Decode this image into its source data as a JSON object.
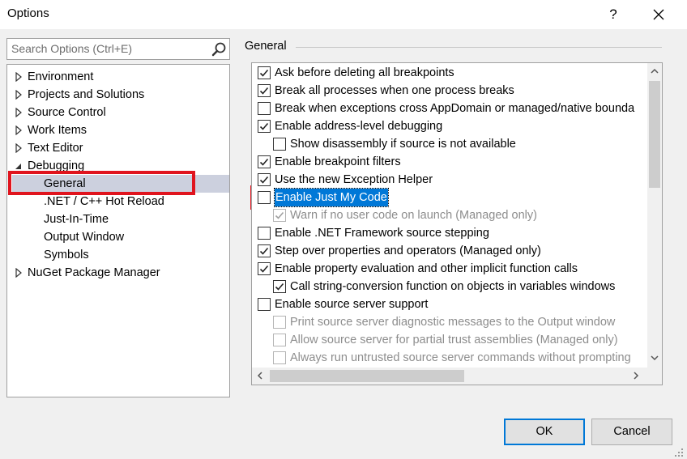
{
  "window": {
    "title": "Options",
    "help_label": "?"
  },
  "search": {
    "placeholder": "Search Options (Ctrl+E)"
  },
  "tree": {
    "items": [
      {
        "label": "Environment",
        "expander": "collapsed"
      },
      {
        "label": "Projects and Solutions",
        "expander": "collapsed"
      },
      {
        "label": "Source Control",
        "expander": "collapsed"
      },
      {
        "label": "Work Items",
        "expander": "collapsed"
      },
      {
        "label": "Text Editor",
        "expander": "collapsed"
      },
      {
        "label": "Debugging",
        "expander": "expanded"
      },
      {
        "label": "General",
        "expander": "none",
        "selected": true
      },
      {
        "label": ".NET / C++ Hot Reload",
        "expander": "none"
      },
      {
        "label": "Just-In-Time",
        "expander": "none"
      },
      {
        "label": "Output Window",
        "expander": "none"
      },
      {
        "label": "Symbols",
        "expander": "none"
      },
      {
        "label": "NuGet Package Manager",
        "expander": "collapsed"
      }
    ]
  },
  "panel": {
    "title": "General",
    "options": [
      {
        "label": "Ask before deleting all breakpoints",
        "checked": true,
        "enabled": true
      },
      {
        "label": "Break all processes when one process breaks",
        "checked": true,
        "enabled": true
      },
      {
        "label": "Break when exceptions cross AppDomain or managed/native bounda",
        "checked": false,
        "enabled": true
      },
      {
        "label": "Enable address-level debugging",
        "checked": true,
        "enabled": true
      },
      {
        "label": "Show disassembly if source is not available",
        "checked": false,
        "enabled": true
      },
      {
        "label": "Enable breakpoint filters",
        "checked": true,
        "enabled": true
      },
      {
        "label": "Use the new Exception Helper",
        "checked": true,
        "enabled": true
      },
      {
        "label": "Enable Just My Code",
        "checked": false,
        "enabled": true,
        "focused": true
      },
      {
        "label": "Warn if no user code on launch (Managed only)",
        "checked": true,
        "enabled": false
      },
      {
        "label": "Enable .NET Framework source stepping",
        "checked": false,
        "enabled": true
      },
      {
        "label": "Step over properties and operators (Managed only)",
        "checked": true,
        "enabled": true
      },
      {
        "label": "Enable property evaluation and other implicit function calls",
        "checked": true,
        "enabled": true
      },
      {
        "label": "Call string-conversion function on objects in variables windows",
        "checked": true,
        "enabled": true
      },
      {
        "label": "Enable source server support",
        "checked": false,
        "enabled": true
      },
      {
        "label": "Print source server diagnostic messages to the Output window",
        "checked": false,
        "enabled": false
      },
      {
        "label": "Allow source server for partial trust assemblies (Managed only)",
        "checked": false,
        "enabled": false
      },
      {
        "label": "Always run untrusted source server commands without prompting",
        "checked": false,
        "enabled": false
      }
    ]
  },
  "buttons": {
    "ok": "OK",
    "cancel": "Cancel"
  },
  "colors": {
    "highlight": "#e0141e",
    "accent": "#0078d7",
    "selection": "#ccd0de"
  },
  "icons": [
    "close-icon",
    "search-icon",
    "expand-arrow-icon",
    "collapse-arrow-icon",
    "check-icon",
    "scroll-up-icon",
    "scroll-down-icon",
    "scroll-left-icon",
    "scroll-right-icon",
    "resize-grip-icon"
  ]
}
